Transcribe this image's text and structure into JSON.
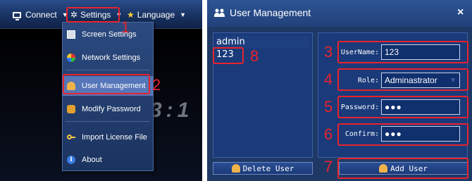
{
  "menubar": {
    "connect": "Connect",
    "settings": "Settings",
    "language": "Language"
  },
  "settings_menu": {
    "items": [
      "Screen Settings",
      "Network Settings",
      "User Management",
      "Modify Password",
      "Import License File",
      "About"
    ]
  },
  "background_text": "3:1",
  "dialog": {
    "title": "User Management",
    "close": "×",
    "users": [
      "admin",
      "123"
    ],
    "fields": {
      "username_label": "UserName:",
      "username_value": "123",
      "role_label": "Role:",
      "role_value": "Adminastrator",
      "password_label": "Password:",
      "password_value": "●●●",
      "confirm_label": "Confirm:",
      "confirm_value": "●●●"
    },
    "delete_button": "Delete User",
    "add_button": "Add User"
  },
  "annotations": [
    "1",
    "2",
    "3",
    "4",
    "5",
    "6",
    "7",
    "8"
  ],
  "colors": {
    "annotation": "#e8232c",
    "menu_bg": "#1f3966",
    "highlight": "#5576b8"
  }
}
